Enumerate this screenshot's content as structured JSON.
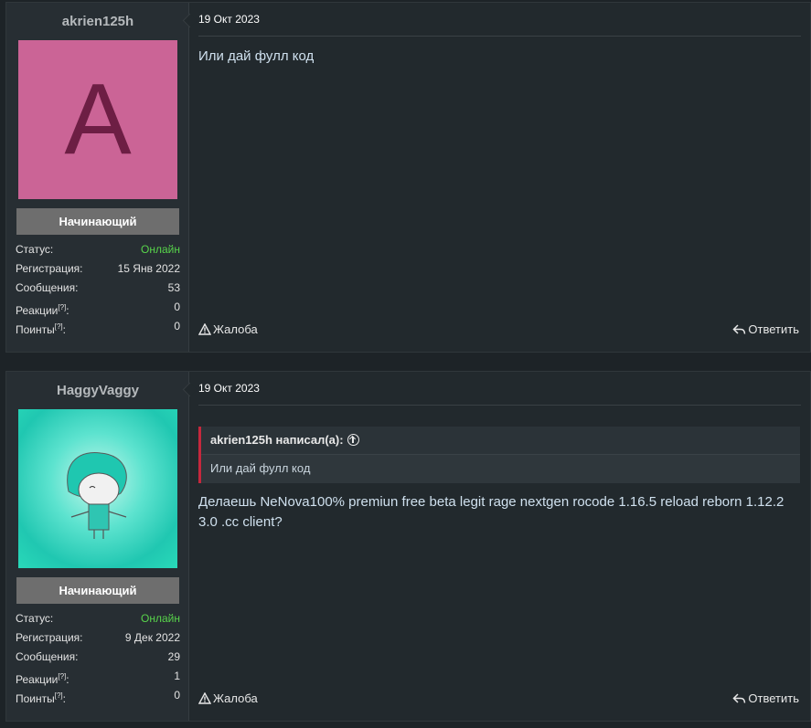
{
  "posts": [
    {
      "username": "akrien125h",
      "avatar_letter": "A",
      "avatar_color": "#cb6496",
      "rank": "Начинающий",
      "stats": {
        "status_label": "Статус:",
        "status_value": "Онлайн",
        "reg_label": "Регистрация:",
        "reg_value": "15 Янв 2022",
        "msgs_label": "Сообщения:",
        "msgs_value": "53",
        "react_label": "Реакции",
        "react_value": "0",
        "points_label": "Поинты",
        "points_value": "0",
        "hint": "[?]"
      },
      "date": "19 Окт 2023",
      "message": "Или дай фулл код",
      "report_label": "Жалоба",
      "reply_label": "Ответить"
    },
    {
      "username": "HaggyVaggy",
      "rank": "Начинающий",
      "stats": {
        "status_label": "Статус:",
        "status_value": "Онлайн",
        "reg_label": "Регистрация:",
        "reg_value": "9 Дек 2022",
        "msgs_label": "Сообщения:",
        "msgs_value": "29",
        "react_label": "Реакции",
        "react_value": "1",
        "points_label": "Поинты",
        "points_value": "0",
        "hint": "[?]"
      },
      "date": "19 Окт 2023",
      "quote_author": "akrien125h написал(а):",
      "quote_text": "Или дай фулл код",
      "message": "Делаешь NeNova100% premiun free beta legit rage nextgen rocode 1.16.5 reload reborn 1.12.2 3.0 .cc client?",
      "report_label": "Жалоба",
      "reply_label": "Ответить"
    }
  ],
  "colors": {
    "online": "#58d44b",
    "quote_bar": "#c5283d",
    "rank_bg": "#6e6e6e"
  }
}
